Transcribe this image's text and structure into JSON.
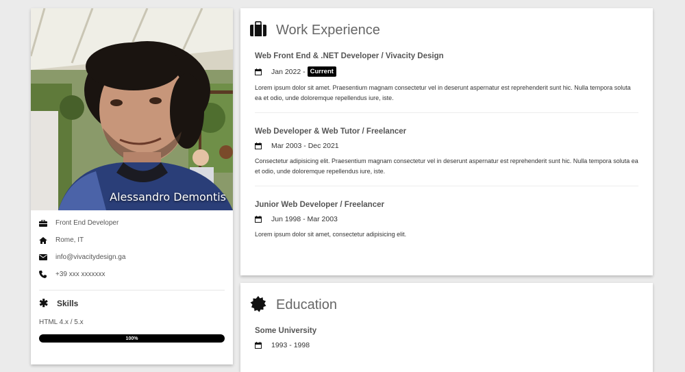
{
  "profile": {
    "name": "Alessandro Demontis",
    "info": [
      {
        "icon": "briefcase-icon",
        "text": "Front End Developer"
      },
      {
        "icon": "home-icon",
        "text": "Rome, IT"
      },
      {
        "icon": "envelope-icon",
        "text": "info@vivacitydesign.ga"
      },
      {
        "icon": "phone-icon",
        "text": "+39 xxx xxxxxxx"
      }
    ],
    "skills_title": "Skills",
    "skills": [
      {
        "name": "HTML 4.x / 5.x",
        "percent_label": "100%",
        "percent": 100
      }
    ]
  },
  "work": {
    "title": "Work Experience",
    "entries": [
      {
        "title": "Web Front End & .NET Developer / Vivacity Design",
        "date": "Jan 2022 -",
        "badge": "Current",
        "desc": "Lorem ipsum dolor sit amet. Praesentium magnam consectetur vel in deserunt aspernatur est reprehenderit sunt hic. Nulla tempora soluta ea et odio, unde doloremque repellendus iure, iste."
      },
      {
        "title": "Web Developer & Web Tutor / Freelancer",
        "date": "Mar 2003 - Dec 2021",
        "desc": "Consectetur adipisicing elit. Praesentium magnam consectetur vel in deserunt aspernatur est reprehenderit sunt hic. Nulla tempora soluta ea et odio, unde doloremque repellendus iure, iste."
      },
      {
        "title": "Junior Web Developer / Freelancer",
        "date": "Jun 1998 - Mar 2003",
        "desc": "Lorem ipsum dolor sit amet, consectetur adipisicing elit."
      }
    ]
  },
  "education": {
    "title": "Education",
    "entries": [
      {
        "title": "Some University",
        "date": "1993 - 1998"
      }
    ]
  },
  "colors": {
    "accent": "#000000",
    "background": "#ebebeb",
    "card": "#ffffff"
  }
}
